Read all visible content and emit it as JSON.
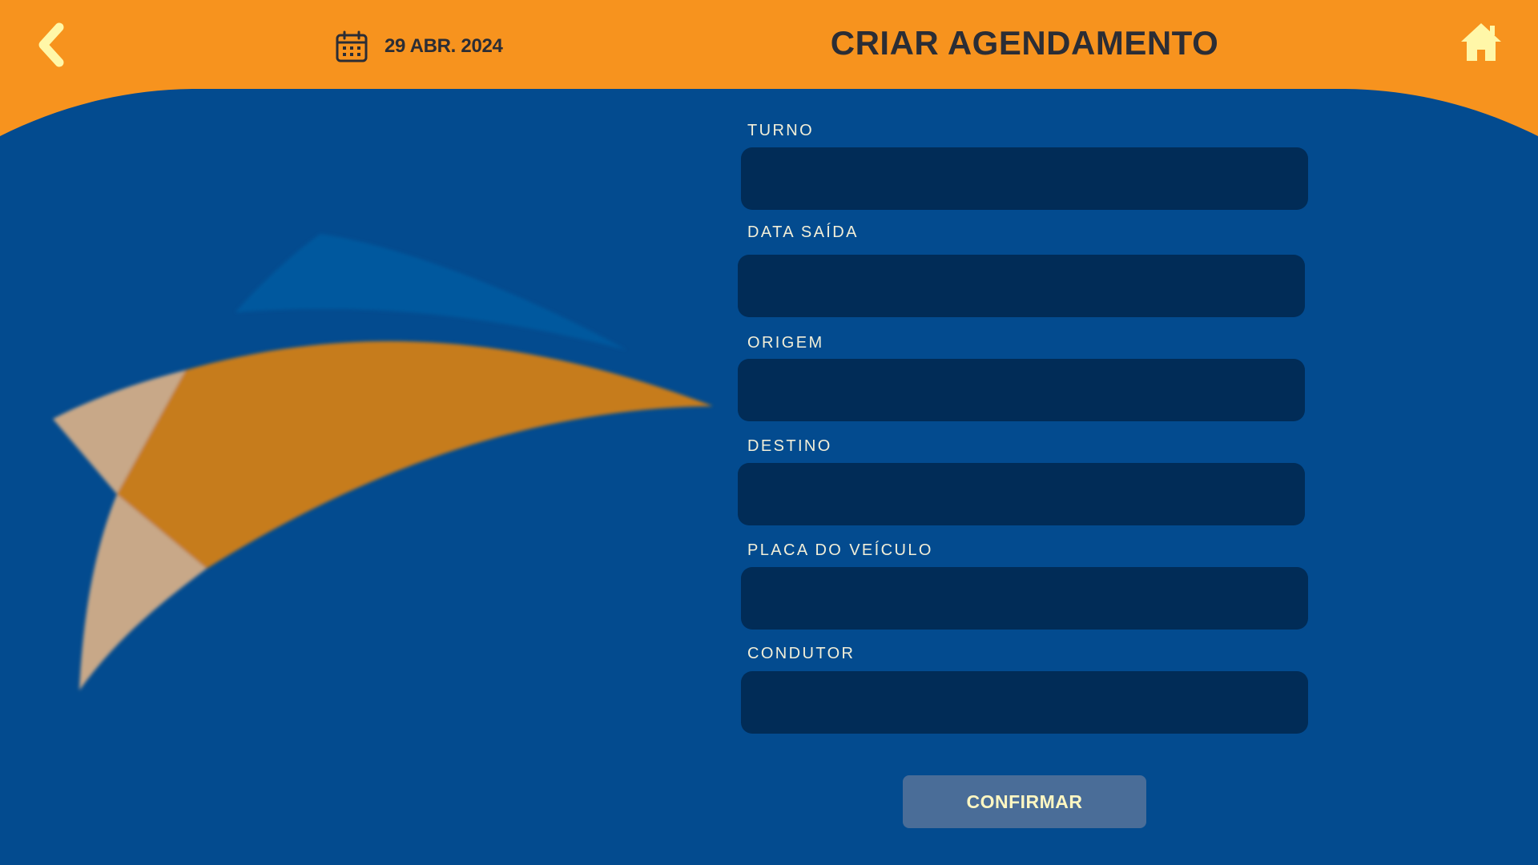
{
  "header": {
    "back_icon": "chevron-left-icon",
    "date_icon": "calendar-icon",
    "date": "29 ABR. 2024",
    "title": "CRIAR AGENDAMENTO",
    "home_icon": "home-icon"
  },
  "form": {
    "fields": [
      {
        "label": "TURNO",
        "value": ""
      },
      {
        "label": "DATA SAÍDA",
        "value": ""
      },
      {
        "label": "ORIGEM",
        "value": ""
      },
      {
        "label": "DESTINO",
        "value": ""
      },
      {
        "label": "PLACA DO VEÍCULO",
        "value": ""
      },
      {
        "label": "CONDUTOR",
        "value": ""
      }
    ],
    "confirm_label": "CONFIRMAR"
  },
  "colors": {
    "header_orange": "#f7931e",
    "background_blue": "#034b8f",
    "input_dark_blue": "#012c57",
    "button_blue": "#4a6d98",
    "accent_yellow": "#fff7a8",
    "title_dark": "#2b2d35"
  }
}
